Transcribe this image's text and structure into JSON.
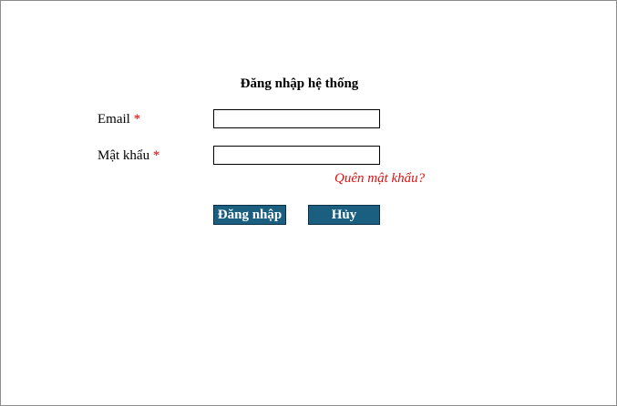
{
  "form": {
    "title": "Đăng nhập hệ thống",
    "email": {
      "label": "Email",
      "required_mark": "*",
      "value": ""
    },
    "password": {
      "label": "Mật khẩu",
      "required_mark": "*",
      "value": ""
    },
    "forgot_password_link": "Quên mật khẩu?",
    "login_button": "Đăng nhập",
    "cancel_button": "Hủy"
  },
  "colors": {
    "required_mark": "#e00000",
    "forgot_link": "#e01010",
    "button_background": "#1a5e80",
    "button_text": "#ffffff"
  }
}
